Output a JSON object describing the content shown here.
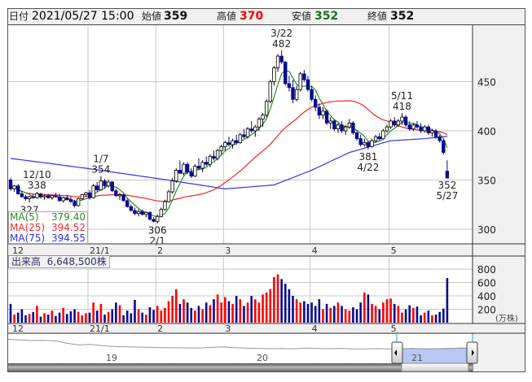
{
  "header": {
    "date_label": "日付",
    "date_value": "2021/05/27 15:00",
    "open_label": "始値",
    "open_value": "359",
    "high_label": "高値",
    "high_value": "370",
    "low_label": "安値",
    "low_value": "352",
    "close_label": "終値",
    "close_value": "352"
  },
  "ma_legend": [
    {
      "name": "MA(5)",
      "value": "379.40",
      "color": "#2e8b2e"
    },
    {
      "name": "MA(25)",
      "value": "394.52",
      "color": "#ff2a2a"
    },
    {
      "name": "MA(75)",
      "value": "394.55",
      "color": "#3030ff"
    }
  ],
  "volume_legend": {
    "label": "出来高",
    "value": "6,648,500株"
  },
  "colors": {
    "up_body": "#ffffff",
    "down_body": "#0a0a90",
    "vol_up": "#ff0000",
    "vol_down": "#0a0a90",
    "vol_flat": "#888888",
    "grid": "#c8c8c8"
  },
  "chart_data": {
    "type": "candlestick",
    "price_axis": {
      "ticks": [
        "450",
        "400",
        "350",
        "300"
      ],
      "tick_values": [
        450,
        400,
        350,
        300
      ],
      "ylim": [
        288,
        500
      ]
    },
    "volume_axis": {
      "ticks": [
        "800",
        "600",
        "400",
        "200"
      ],
      "tick_values": [
        800,
        600,
        400,
        200
      ],
      "unit": "(万株)",
      "ylim": [
        0,
        850
      ]
    },
    "date_ticks": [
      {
        "label": "12",
        "index": 0
      },
      {
        "label": "21/1",
        "index": 21
      },
      {
        "label": "2",
        "index": 39
      },
      {
        "label": "3",
        "index": 57
      },
      {
        "label": "4",
        "index": 80
      },
      {
        "label": "5",
        "index": 101
      }
    ],
    "candles_ohlc": [
      [
        350,
        352,
        339,
        341
      ],
      [
        341,
        345,
        338,
        344
      ],
      [
        344,
        346,
        335,
        336
      ],
      [
        336,
        339,
        332,
        333
      ],
      [
        333,
        335,
        329,
        331
      ],
      [
        331,
        334,
        327,
        333
      ],
      [
        333,
        336,
        331,
        332
      ],
      [
        332,
        338,
        331,
        336
      ],
      [
        336,
        337,
        331,
        333
      ],
      [
        333,
        335,
        330,
        334
      ],
      [
        334,
        336,
        331,
        332
      ],
      [
        332,
        335,
        330,
        334
      ],
      [
        334,
        337,
        332,
        333
      ],
      [
        333,
        336,
        328,
        329
      ],
      [
        329,
        333,
        327,
        332
      ],
      [
        332,
        335,
        329,
        330
      ],
      [
        330,
        333,
        327,
        328
      ],
      [
        328,
        330,
        322,
        324
      ],
      [
        324,
        332,
        323,
        331
      ],
      [
        331,
        336,
        330,
        335
      ],
      [
        335,
        338,
        333,
        337
      ],
      [
        337,
        340,
        330,
        332
      ],
      [
        332,
        346,
        331,
        344
      ],
      [
        344,
        348,
        338,
        340
      ],
      [
        340,
        354,
        339,
        349
      ],
      [
        349,
        351,
        341,
        344
      ],
      [
        344,
        350,
        342,
        348
      ],
      [
        348,
        349,
        338,
        339
      ],
      [
        339,
        341,
        333,
        334
      ],
      [
        334,
        337,
        330,
        335
      ],
      [
        335,
        336,
        328,
        329
      ],
      [
        329,
        331,
        322,
        323
      ],
      [
        323,
        325,
        318,
        319
      ],
      [
        319,
        322,
        314,
        316
      ],
      [
        316,
        320,
        313,
        318
      ],
      [
        318,
        320,
        314,
        315
      ],
      [
        315,
        318,
        312,
        317
      ],
      [
        317,
        318,
        309,
        310
      ],
      [
        310,
        312,
        307,
        308
      ],
      [
        308,
        315,
        306,
        313
      ],
      [
        313,
        322,
        312,
        320
      ],
      [
        320,
        330,
        319,
        328
      ],
      [
        328,
        340,
        327,
        338
      ],
      [
        338,
        352,
        336,
        349
      ],
      [
        349,
        362,
        347,
        360
      ],
      [
        360,
        370,
        356,
        357
      ],
      [
        357,
        368,
        355,
        366
      ],
      [
        366,
        368,
        356,
        358
      ],
      [
        358,
        362,
        352,
        354
      ],
      [
        354,
        366,
        353,
        364
      ],
      [
        364,
        372,
        360,
        362
      ],
      [
        362,
        370,
        358,
        368
      ],
      [
        368,
        374,
        364,
        366
      ],
      [
        366,
        376,
        363,
        374
      ],
      [
        374,
        380,
        370,
        372
      ],
      [
        372,
        382,
        370,
        380
      ],
      [
        380,
        386,
        376,
        384
      ],
      [
        384,
        390,
        380,
        388
      ],
      [
        388,
        394,
        384,
        386
      ],
      [
        386,
        392,
        382,
        390
      ],
      [
        390,
        396,
        386,
        388
      ],
      [
        388,
        398,
        387,
        396
      ],
      [
        396,
        402,
        392,
        394
      ],
      [
        394,
        404,
        392,
        402
      ],
      [
        402,
        410,
        398,
        400
      ],
      [
        400,
        406,
        394,
        404
      ],
      [
        404,
        414,
        400,
        412
      ],
      [
        412,
        418,
        404,
        416
      ],
      [
        416,
        432,
        414,
        430
      ],
      [
        430,
        452,
        428,
        450
      ],
      [
        450,
        466,
        446,
        464
      ],
      [
        464,
        478,
        460,
        476
      ],
      [
        476,
        482,
        468,
        470
      ],
      [
        470,
        471,
        446,
        448
      ],
      [
        448,
        456,
        440,
        444
      ],
      [
        444,
        452,
        428,
        432
      ],
      [
        432,
        446,
        430,
        442
      ],
      [
        442,
        460,
        440,
        458
      ],
      [
        458,
        462,
        450,
        452
      ],
      [
        452,
        456,
        440,
        442
      ],
      [
        442,
        446,
        430,
        432
      ],
      [
        432,
        436,
        420,
        424
      ],
      [
        424,
        428,
        412,
        416
      ],
      [
        416,
        424,
        412,
        420
      ],
      [
        420,
        422,
        406,
        408
      ],
      [
        408,
        414,
        402,
        410
      ],
      [
        410,
        412,
        400,
        402
      ],
      [
        402,
        408,
        398,
        406
      ],
      [
        406,
        410,
        398,
        400
      ],
      [
        400,
        406,
        396,
        404
      ],
      [
        404,
        412,
        402,
        408
      ],
      [
        408,
        410,
        396,
        398
      ],
      [
        398,
        400,
        390,
        392
      ],
      [
        392,
        396,
        384,
        386
      ],
      [
        386,
        392,
        384,
        388
      ],
      [
        388,
        390,
        381,
        384
      ],
      [
        384,
        392,
        383,
        390
      ],
      [
        390,
        396,
        388,
        394
      ],
      [
        394,
        398,
        390,
        392
      ],
      [
        392,
        402,
        391,
        400
      ],
      [
        400,
        406,
        398,
        404
      ],
      [
        404,
        412,
        402,
        410
      ],
      [
        410,
        414,
        404,
        406
      ],
      [
        406,
        412,
        404,
        410
      ],
      [
        410,
        418,
        406,
        414
      ],
      [
        414,
        416,
        404,
        406
      ],
      [
        406,
        410,
        400,
        402
      ],
      [
        402,
        408,
        400,
        406
      ],
      [
        406,
        410,
        402,
        404
      ],
      [
        404,
        408,
        398,
        400
      ],
      [
        400,
        406,
        398,
        404
      ],
      [
        404,
        406,
        396,
        398
      ],
      [
        398,
        402,
        394,
        400
      ],
      [
        400,
        402,
        392,
        394
      ],
      [
        394,
        396,
        388,
        390
      ],
      [
        390,
        392,
        376,
        378
      ],
      [
        359,
        370,
        352,
        352
      ]
    ],
    "volumes": [
      280,
      120,
      150,
      200,
      110,
      130,
      160,
      250,
      90,
      140,
      120,
      180,
      100,
      150,
      220,
      130,
      170,
      200,
      160,
      110,
      140,
      150,
      300,
      180,
      280,
      120,
      160,
      200,
      300,
      260,
      110,
      180,
      140,
      340,
      200,
      150,
      120,
      230,
      190,
      250,
      180,
      220,
      320,
      400,
      500,
      280,
      350,
      300,
      220,
      180,
      250,
      200,
      300,
      260,
      350,
      420,
      300,
      380,
      320,
      280,
      400,
      350,
      250,
      300,
      400,
      350,
      300,
      420,
      450,
      500,
      680,
      720,
      650,
      580,
      500,
      400,
      350,
      300,
      320,
      280,
      300,
      250,
      350,
      200,
      280,
      220,
      250,
      300,
      250,
      200,
      180,
      230,
      200,
      300,
      450,
      420,
      280,
      250,
      200,
      300,
      350,
      360,
      280,
      250,
      150,
      200,
      260,
      220,
      240,
      110,
      150,
      180,
      110,
      120,
      160,
      210,
      665
    ],
    "ma75_points": [
      [
        0,
        372
      ],
      [
        20,
        362
      ],
      [
        40,
        351
      ],
      [
        57,
        341
      ],
      [
        70,
        345
      ],
      [
        80,
        360
      ],
      [
        90,
        378
      ],
      [
        101,
        390
      ],
      [
        110,
        392
      ],
      [
        116,
        394.55
      ]
    ],
    "annotations": [
      {
        "index": 7,
        "date": "12/10",
        "value": "338",
        "pos": "above"
      },
      {
        "index": 5,
        "date": "",
        "value": "327",
        "pos": "below"
      },
      {
        "index": 24,
        "date": "1/7",
        "value": "354",
        "pos": "above"
      },
      {
        "index": 39,
        "date": "2/1",
        "value": "306",
        "pos": "below"
      },
      {
        "index": 72,
        "date": "3/22",
        "value": "482",
        "pos": "above"
      },
      {
        "index": 95,
        "date": "4/22",
        "value": "381",
        "pos": "below"
      },
      {
        "index": 104,
        "date": "5/11",
        "value": "418",
        "pos": "above"
      },
      {
        "index": 116,
        "date": "5/27",
        "value": "352",
        "pos": "below"
      }
    ]
  },
  "navigator": {
    "year_labels": [
      "19",
      "20",
      "21"
    ],
    "values": [
      560,
      556,
      552,
      553,
      548,
      530,
      518,
      522,
      512,
      506,
      504,
      502,
      500,
      498,
      497,
      496,
      495,
      500,
      503,
      498,
      494,
      492,
      490,
      492,
      489,
      494,
      492,
      490,
      491,
      489,
      488,
      490,
      488,
      489,
      491,
      489,
      490,
      492,
      494,
      493
    ]
  }
}
